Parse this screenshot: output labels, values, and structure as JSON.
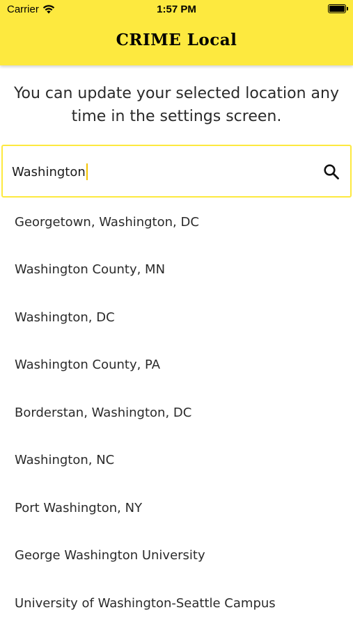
{
  "status_bar": {
    "carrier": "Carrier",
    "time": "1:57 PM"
  },
  "header": {
    "title": "CRIME Local",
    "background_color": "#fde93f"
  },
  "instructions": "You can update your selected location any time in the settings screen.",
  "search": {
    "value": "Washington",
    "border_color": "#fde93f"
  },
  "results": [
    "Georgetown, Washington, DC",
    "Washington County, MN",
    "Washington, DC",
    "Washington County, PA",
    "Borderstan, Washington, DC",
    "Washington, NC",
    "Port Washington, NY",
    "George Washington University",
    "University of Washington-Seattle Campus"
  ]
}
